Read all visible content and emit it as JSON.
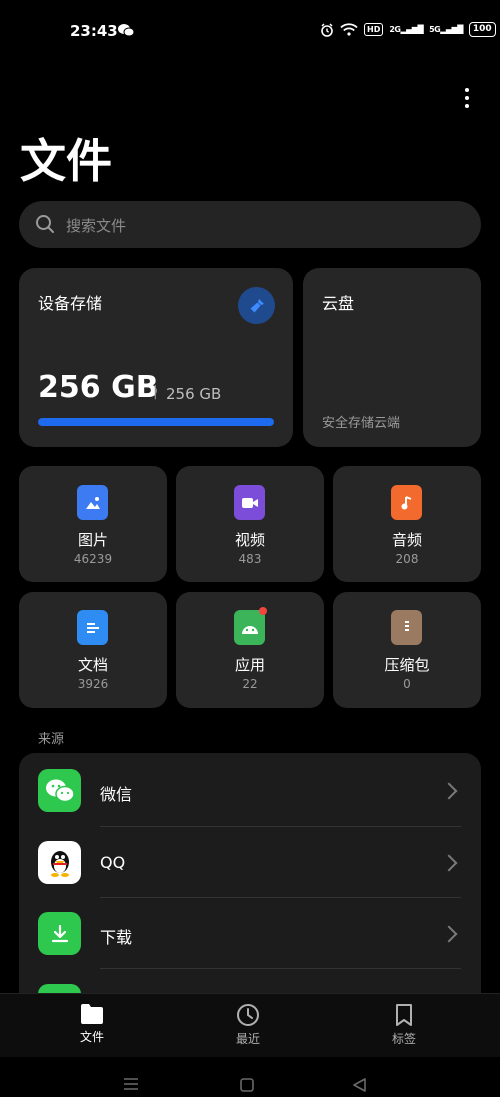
{
  "status_bar": {
    "time": "23:43",
    "hd": "HD",
    "net1": "2G",
    "net2": "5G",
    "battery": "100"
  },
  "header": {
    "title": "文件"
  },
  "search": {
    "placeholder": "搜索文件"
  },
  "storage": {
    "title": "设备存储",
    "used": "256 GB",
    "separator": "|",
    "total": "256 GB",
    "used_fraction": 1.0
  },
  "cloud": {
    "title": "云盘",
    "subtitle": "安全存储云端"
  },
  "categories": [
    {
      "label": "图片",
      "count": "46239"
    },
    {
      "label": "视频",
      "count": "483"
    },
    {
      "label": "音频",
      "count": "208"
    },
    {
      "label": "文档",
      "count": "3926"
    },
    {
      "label": "应用",
      "count": "22"
    },
    {
      "label": "压缩包",
      "count": "0"
    }
  ],
  "sources": {
    "label": "来源",
    "items": [
      {
        "label": "微信"
      },
      {
        "label": "QQ"
      },
      {
        "label": "下载"
      }
    ]
  },
  "bottom_nav": {
    "items": [
      {
        "label": "文件"
      },
      {
        "label": "最近"
      },
      {
        "label": "标签"
      }
    ]
  },
  "colors": {
    "accent": "#1e6bf0",
    "images": "#3d7bf2",
    "video": "#7b4dd9",
    "audio": "#f26a2e",
    "docs": "#2f8cf2",
    "apps": "#3cb45a",
    "archive": "#9b7a62",
    "wechat": "#2dc84d",
    "download": "#2dc84d"
  }
}
